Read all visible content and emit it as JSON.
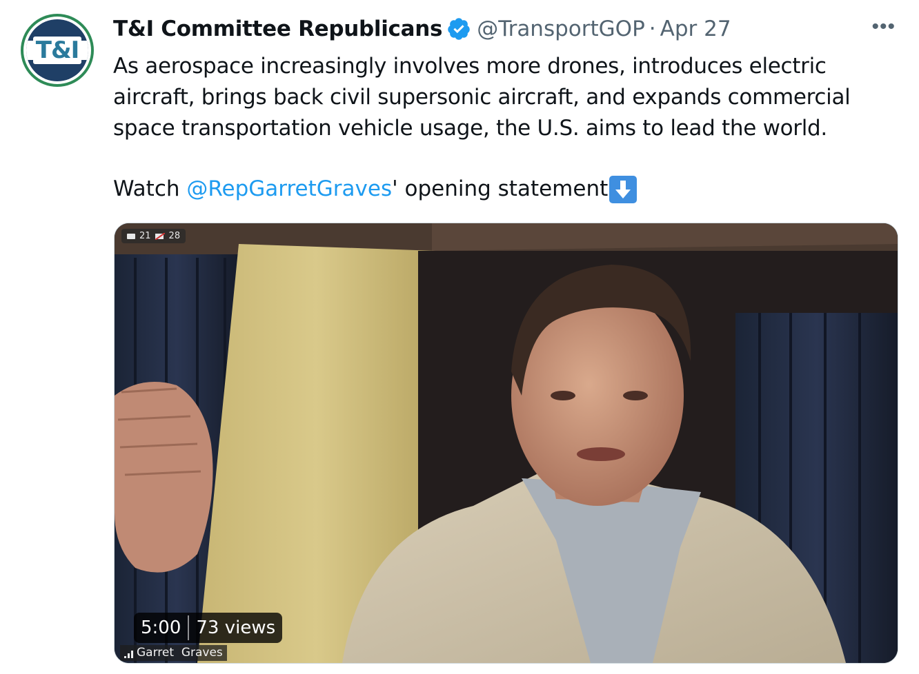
{
  "author": {
    "avatar_text": "T&I",
    "display_name": "T&I Committee Republicans",
    "handle": "@TransportGOP",
    "separator": "·",
    "date": "Apr 27",
    "verified_icon": "verified-badge-icon",
    "more_icon": "more-options-icon",
    "more_label": "•••"
  },
  "tweet": {
    "text": "As aerospace increasingly involves more drones, introduces electric aircraft, brings back civil supersonic aircraft, and expands commercial space transportation vehicle usage, the U.S. aims to lead the world.",
    "watch_prefix": "Watch ",
    "mention": "@RepGarretGraves",
    "watch_suffix": "' opening statement",
    "emoji_icon": "down-arrow-emoji-icon"
  },
  "media": {
    "camera_count": "21",
    "camera_off_count": "28",
    "duration": "5:00",
    "views": "73 views",
    "participant_name": "Garret  Graves"
  },
  "colors": {
    "text_primary": "#0f1419",
    "text_secondary": "#536471",
    "link": "#1d9bf0",
    "verified": "#1d9bf0"
  }
}
